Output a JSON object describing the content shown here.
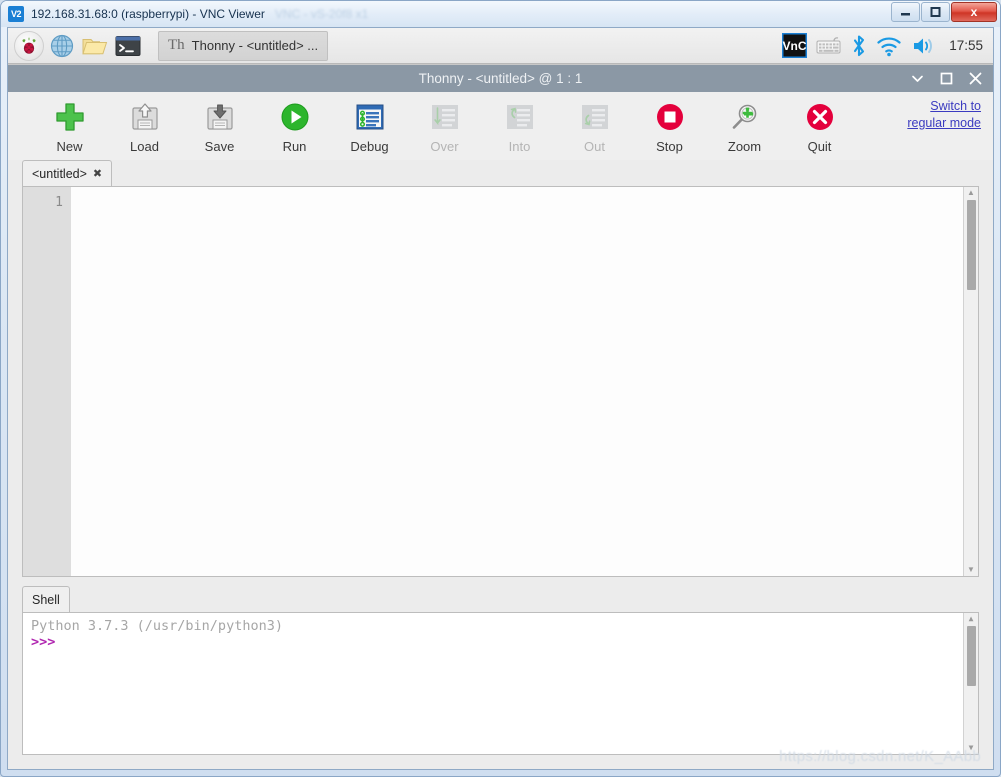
{
  "vnc": {
    "logo_text": "V2",
    "title": "192.168.31.68:0 (raspberrypi) - VNC Viewer",
    "ghost_title": "VNC - vS-20f8 x1",
    "window_buttons": {
      "minimize": "minimize-icon",
      "maximize": "maximize-icon",
      "close": "x"
    }
  },
  "taskbar": {
    "launchers": [
      {
        "name": "raspberry-pi-menu",
        "label": "Raspberry Pi Menu"
      },
      {
        "name": "web-browser",
        "label": "Web Browser"
      },
      {
        "name": "file-manager",
        "label": "File Manager"
      },
      {
        "name": "terminal",
        "label": "Terminal"
      }
    ],
    "task_button": {
      "icon": "Th",
      "label": "Thonny  -  <untitled>  ..."
    },
    "tray": [
      {
        "name": "vnc-server-icon",
        "label": "VNC Server"
      },
      {
        "name": "keyboard-icon",
        "label": "Onscreen Keyboard"
      },
      {
        "name": "bluetooth-icon",
        "label": "Bluetooth"
      },
      {
        "name": "wifi-icon",
        "label": "Wireless Network"
      },
      {
        "name": "volume-icon",
        "label": "Volume"
      }
    ],
    "clock": "17:55"
  },
  "thonny": {
    "title": "Thonny  -  <untitled>  @  1 : 1",
    "window_buttons": {
      "minimize": "⌄",
      "maximize": "□",
      "close": "✕"
    },
    "toolbar": [
      {
        "label": "New",
        "icon": "new-icon",
        "enabled": true
      },
      {
        "label": "Load",
        "icon": "load-icon",
        "enabled": true
      },
      {
        "label": "Save",
        "icon": "save-icon",
        "enabled": true
      },
      {
        "label": "Run",
        "icon": "run-icon",
        "enabled": true
      },
      {
        "label": "Debug",
        "icon": "debug-icon",
        "enabled": true
      },
      {
        "label": "Over",
        "icon": "step-over-icon",
        "enabled": false
      },
      {
        "label": "Into",
        "icon": "step-into-icon",
        "enabled": false
      },
      {
        "label": "Out",
        "icon": "step-out-icon",
        "enabled": false
      },
      {
        "label": "Stop",
        "icon": "stop-icon",
        "enabled": true
      },
      {
        "label": "Zoom",
        "icon": "zoom-icon",
        "enabled": true
      },
      {
        "label": "Quit",
        "icon": "quit-icon",
        "enabled": true
      }
    ],
    "switch_mode_link": "Switch to regular mode",
    "editor": {
      "tab_label": "<untitled>",
      "tab_close": "✖",
      "line_numbers": [
        "1"
      ],
      "content": ""
    },
    "shell": {
      "tab_label": "Shell",
      "banner": "Python 3.7.3 (/usr/bin/python3)",
      "prompt": ">>>",
      "input": ""
    }
  },
  "watermark": "https://blog.csdn.net/K_AAbb",
  "colors": {
    "thonny_titlebar": "#8b98a5",
    "toolbar_bg": "#efefef",
    "accent_green": "#4cb14c",
    "accent_red": "#e4003c",
    "link_blue": "#3b3bc0",
    "prompt_magenta": "#b026b0"
  }
}
